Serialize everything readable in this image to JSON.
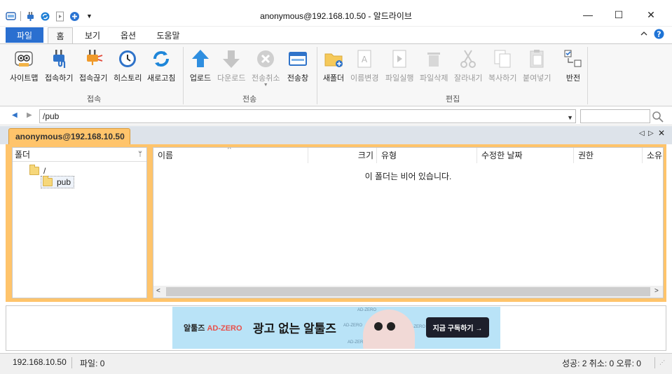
{
  "window": {
    "title": "anonymous@192.168.10.50 - 알드라이브",
    "minimize": "—",
    "maximize": "☐",
    "close": "✕"
  },
  "ribbon_tabs": {
    "file": "파일",
    "items": [
      "홈",
      "보기",
      "옵션",
      "도움말"
    ],
    "active": "홈"
  },
  "ribbon": {
    "groups": {
      "connect": "접속",
      "transfer": "전송",
      "edit": "편집"
    },
    "buttons": {
      "sitemap": "사이트맵",
      "connect": "접속하기",
      "disconnect": "접속끊기",
      "history": "히스토리",
      "refresh": "새로고침",
      "upload": "업로드",
      "download": "다운로드",
      "cancel_transfer": "전송취소",
      "transfer_window": "전송창",
      "new_folder": "새폴더",
      "rename": "이름변경",
      "run_file": "파일실행",
      "delete_file": "파일삭제",
      "cut": "잘라내기",
      "copy": "복사하기",
      "paste": "붙여넣기",
      "invert": "반전"
    }
  },
  "address": {
    "path": "/pub",
    "search_value": ""
  },
  "session_tab": {
    "label": "anonymous@192.168.10.50"
  },
  "folder_pane": {
    "header": "폴더",
    "pin": "ᛘ",
    "tree": [
      "/",
      "pub"
    ]
  },
  "file_pane": {
    "columns": [
      "이름",
      "크기",
      "유형",
      "수정한 날짜",
      "권한",
      "소유"
    ],
    "empty_message": "이 폴더는 비어 있습니다."
  },
  "ad": {
    "brand_prefix": "알툴즈",
    "brand_highlight": "AD-ZERO",
    "headline": "광고 없는 알툴즈",
    "cta": "지금 구독하기 →",
    "deco": [
      "AD-ZERO",
      "AD-ZERO",
      "AD-ZERO",
      "AD-ZERO"
    ]
  },
  "status": {
    "host": "192.168.10.50",
    "files": "파일: 0",
    "summary": "성공: 2 취소: 0 오류: 0"
  }
}
